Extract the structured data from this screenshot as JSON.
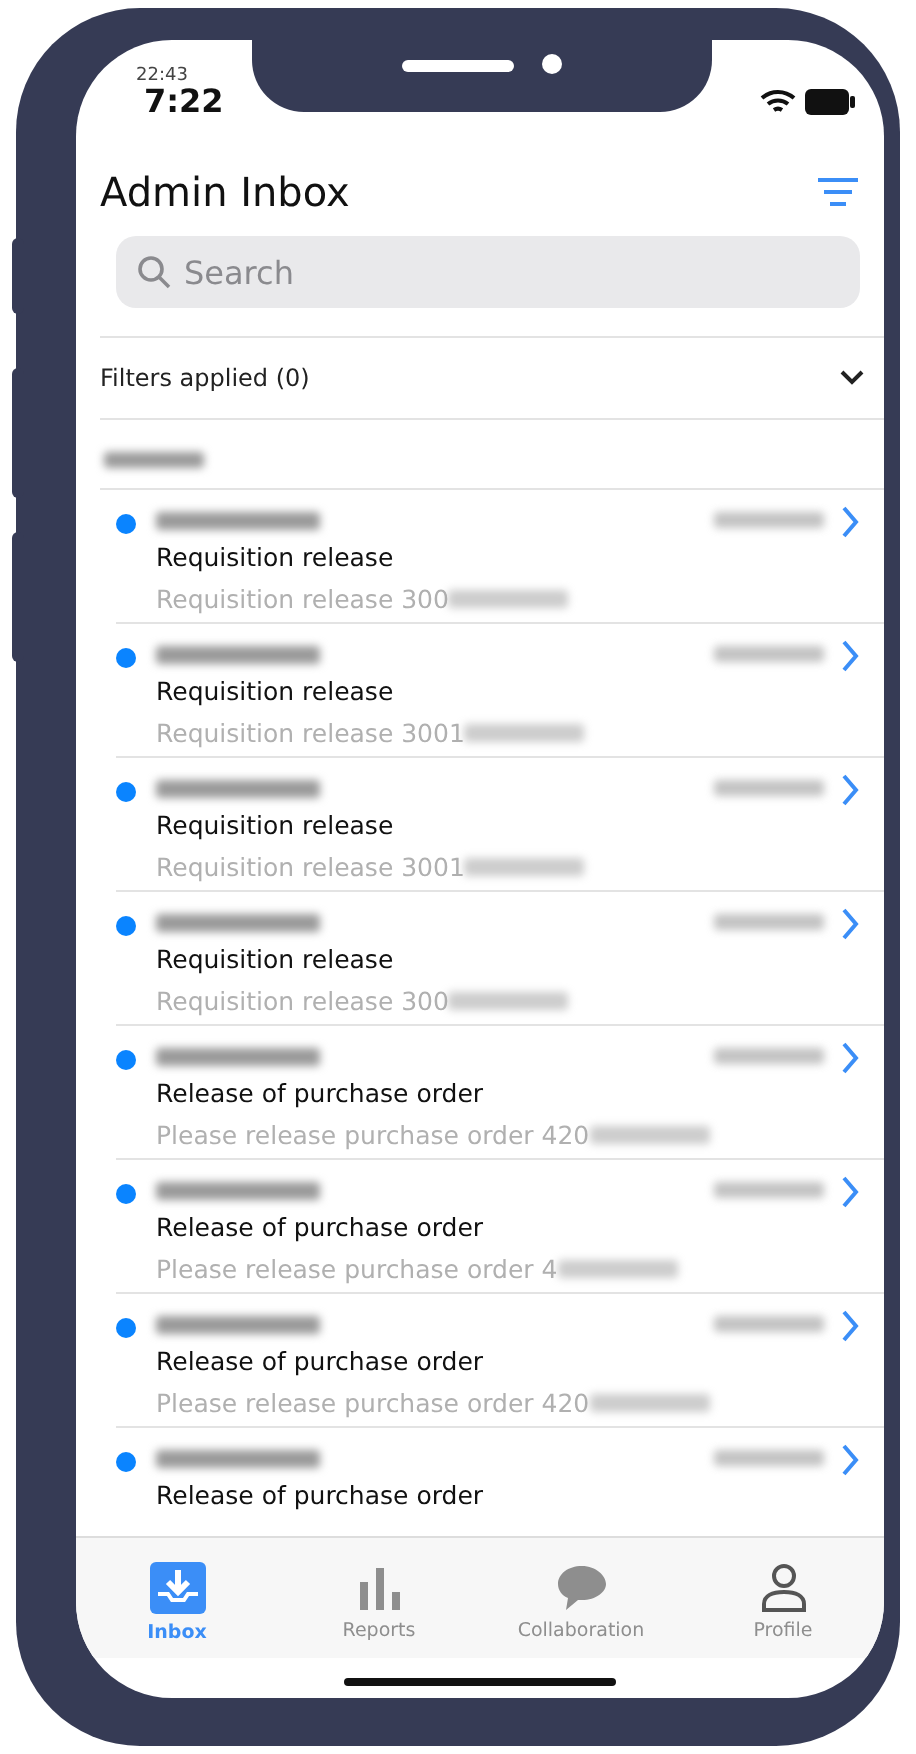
{
  "status_bar": {
    "time": "7:22",
    "time_overlay": "22:43"
  },
  "header": {
    "title": "Admin Inbox"
  },
  "search": {
    "placeholder": "Search"
  },
  "filters": {
    "label": "Filters applied (0)",
    "expanded": false
  },
  "messages": [
    {
      "unread": true,
      "title": "Requisition release",
      "description": "Requisition release 300"
    },
    {
      "unread": true,
      "title": "Requisition release",
      "description": "Requisition release 3001"
    },
    {
      "unread": true,
      "title": "Requisition release",
      "description": "Requisition release 3001"
    },
    {
      "unread": true,
      "title": "Requisition release",
      "description": "Requisition release 300"
    },
    {
      "unread": true,
      "title": "Release of purchase order",
      "description": "Please release purchase order 420"
    },
    {
      "unread": true,
      "title": "Release of purchase order",
      "description": "Please release purchase order 4"
    },
    {
      "unread": true,
      "title": "Release of purchase order",
      "description": "Please release purchase order 420"
    },
    {
      "unread": true,
      "title": "Release of purchase order"
    }
  ],
  "tabs": [
    {
      "label": "Inbox",
      "kind": "inbox",
      "selected": true
    },
    {
      "label": "Reports",
      "kind": "reports",
      "selected": false
    },
    {
      "label": "Collaboration",
      "kind": "chat",
      "selected": false
    },
    {
      "label": "Profile",
      "kind": "profile",
      "selected": false
    }
  ]
}
